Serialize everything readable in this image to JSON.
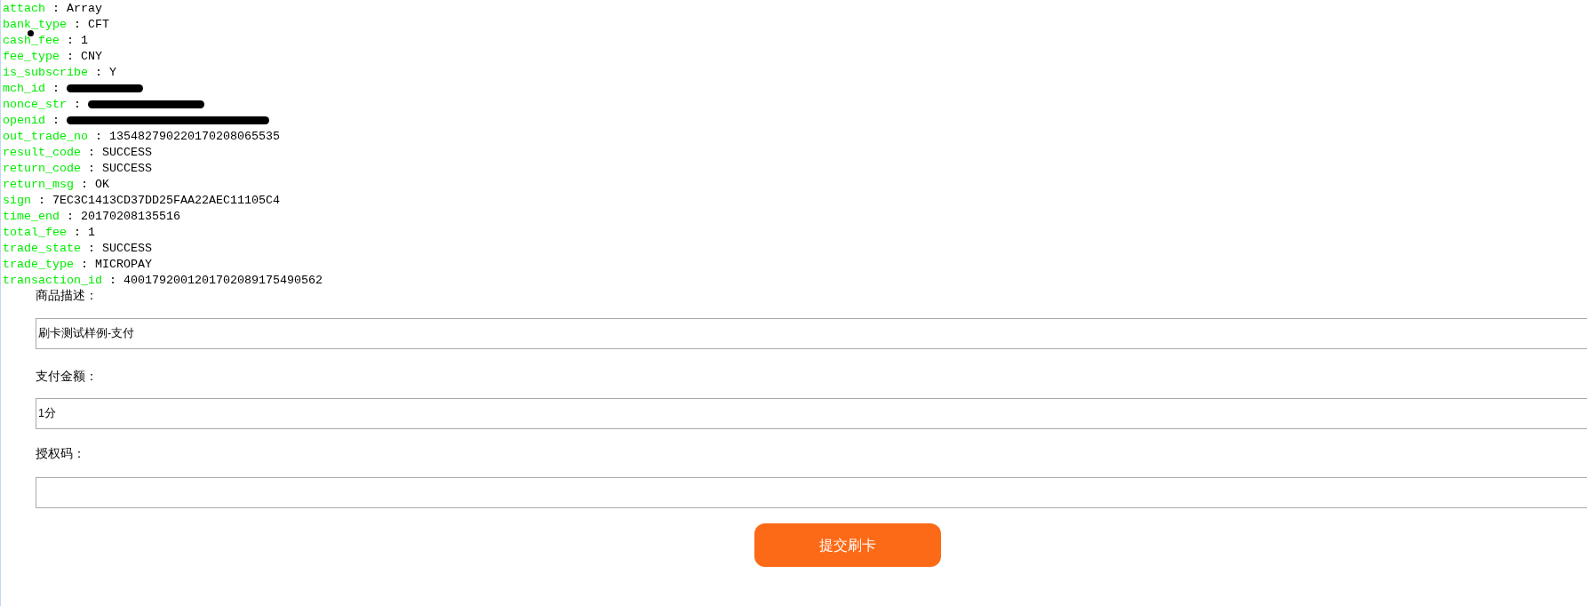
{
  "fields": [
    {
      "key": "attach",
      "separator": ":",
      "value": "Array",
      "redacted": false
    },
    {
      "key": "bank_type",
      "separator": ":",
      "value": "CFT",
      "redacted": false
    },
    {
      "key": "cash_fee",
      "separator": ":",
      "value": "1",
      "redacted": false
    },
    {
      "key": "fee_type",
      "separator": ":",
      "value": "CNY",
      "redacted": false
    },
    {
      "key": "is_subscribe",
      "separator": ":",
      "value": "Y",
      "redacted": false
    },
    {
      "key": "mch_id",
      "separator": ":",
      "redacted": true
    },
    {
      "key": "nonce_str",
      "separator": ":",
      "redacted": true
    },
    {
      "key": "openid",
      "separator": ":",
      "redacted": true
    },
    {
      "key": "out_trade_no",
      "separator": ":",
      "value": "135482790220170208065535",
      "redacted": false
    },
    {
      "key": "result_code",
      "separator": ":",
      "value": "SUCCESS",
      "redacted": false
    },
    {
      "key": "return_code",
      "separator": ":",
      "value": "SUCCESS",
      "redacted": false
    },
    {
      "key": "return_msg",
      "separator": ":",
      "value": "OK",
      "redacted": false
    },
    {
      "key": "sign",
      "separator": ":",
      "value": "7EC3C1413CD37DD25FAA22AEC11105C4",
      "redacted": false
    },
    {
      "key": "time_end",
      "separator": ":",
      "value": "20170208135516",
      "redacted": false
    },
    {
      "key": "total_fee",
      "separator": ":",
      "value": "1",
      "redacted": false
    },
    {
      "key": "trade_state",
      "separator": ":",
      "value": "SUCCESS",
      "redacted": false
    },
    {
      "key": "trade_type",
      "separator": ":",
      "value": "MICROPAY",
      "redacted": false
    },
    {
      "key": "transaction_id",
      "separator": ":",
      "value": "4001792001201702089175490562",
      "redacted": false
    }
  ],
  "form": {
    "inputs": [
      {
        "label": "商品描述：",
        "value": "刷卡测试样例-支付"
      },
      {
        "label": "支付金额：",
        "value": "1分"
      },
      {
        "label": "授权码："
      }
    ],
    "submit_button": "提交刷卡"
  }
}
